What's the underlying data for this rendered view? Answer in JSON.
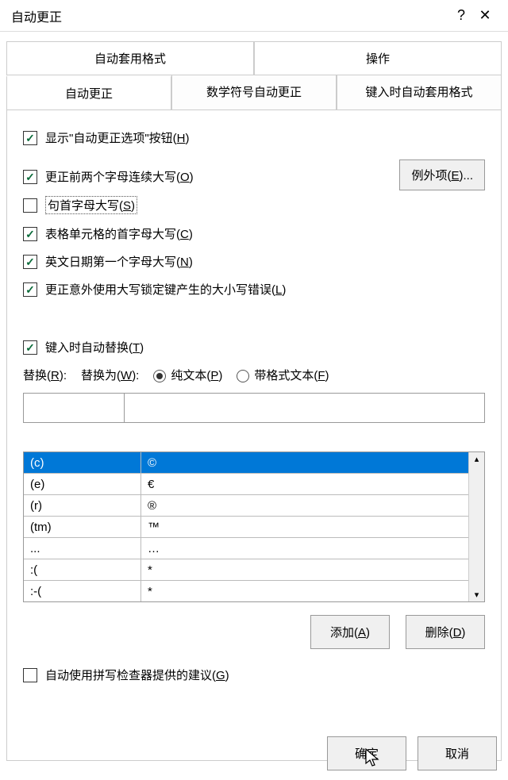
{
  "title": "自动更正",
  "help_char": "?",
  "close_char": "✕",
  "tabs_row1": [
    "自动套用格式",
    "操作"
  ],
  "tabs_row2": [
    "自动更正",
    "数学符号自动更正",
    "键入时自动套用格式"
  ],
  "checkboxes": {
    "show_btn": {
      "label_pre": "显示\"自动更正选项\"按钮(",
      "key": "H",
      "label_post": ")",
      "checked": true
    },
    "two_caps": {
      "label_pre": "更正前两个字母连续大写(",
      "key": "O",
      "label_post": ")",
      "checked": true
    },
    "sentence": {
      "label_pre": "句首字母大写(",
      "key": "S",
      "label_post": ")",
      "checked": false,
      "focused": true
    },
    "table_cell": {
      "label_pre": "表格单元格的首字母大写(",
      "key": "C",
      "label_post": ")",
      "checked": true
    },
    "weekday": {
      "label_pre": "英文日期第一个字母大写(",
      "key": "N",
      "label_post": ")",
      "checked": true
    },
    "capslock": {
      "label_pre": "更正意外使用大写锁定键产生的大小写错误(",
      "key": "L",
      "label_post": ")",
      "checked": true
    },
    "replace_on": {
      "label_pre": "键入时自动替换(",
      "key": "T",
      "label_post": ")",
      "checked": true
    },
    "spell": {
      "label_pre": "自动使用拼写检查器提供的建议(",
      "key": "G",
      "label_post": ")",
      "checked": false
    }
  },
  "exceptions_btn": {
    "label_pre": "例外项(",
    "key": "E",
    "label_post": ")..."
  },
  "replace_label": {
    "pre": "替换(",
    "key": "R",
    "post": "):"
  },
  "replace_with_label": {
    "pre": "替换为(",
    "key": "W",
    "post": "):"
  },
  "radio_plain": {
    "pre": "纯文本(",
    "key": "P",
    "post": ")"
  },
  "radio_formatted": {
    "pre": "带格式文本(",
    "key": "F",
    "post": ")"
  },
  "table": {
    "rows": [
      {
        "a": "(c)",
        "b": "©",
        "selected": true
      },
      {
        "a": "(e)",
        "b": "€"
      },
      {
        "a": "(r)",
        "b": "®"
      },
      {
        "a": "(tm)",
        "b": "™"
      },
      {
        "a": "...",
        "b": "…"
      },
      {
        "a": ":(",
        "b": "*"
      },
      {
        "a": ":-(",
        "b": "*"
      }
    ]
  },
  "add_btn": {
    "pre": "添加(",
    "key": "A",
    "post": ")"
  },
  "del_btn": {
    "pre": "删除(",
    "key": "D",
    "post": ")"
  },
  "ok_btn": "确定",
  "cancel_btn": "取消"
}
